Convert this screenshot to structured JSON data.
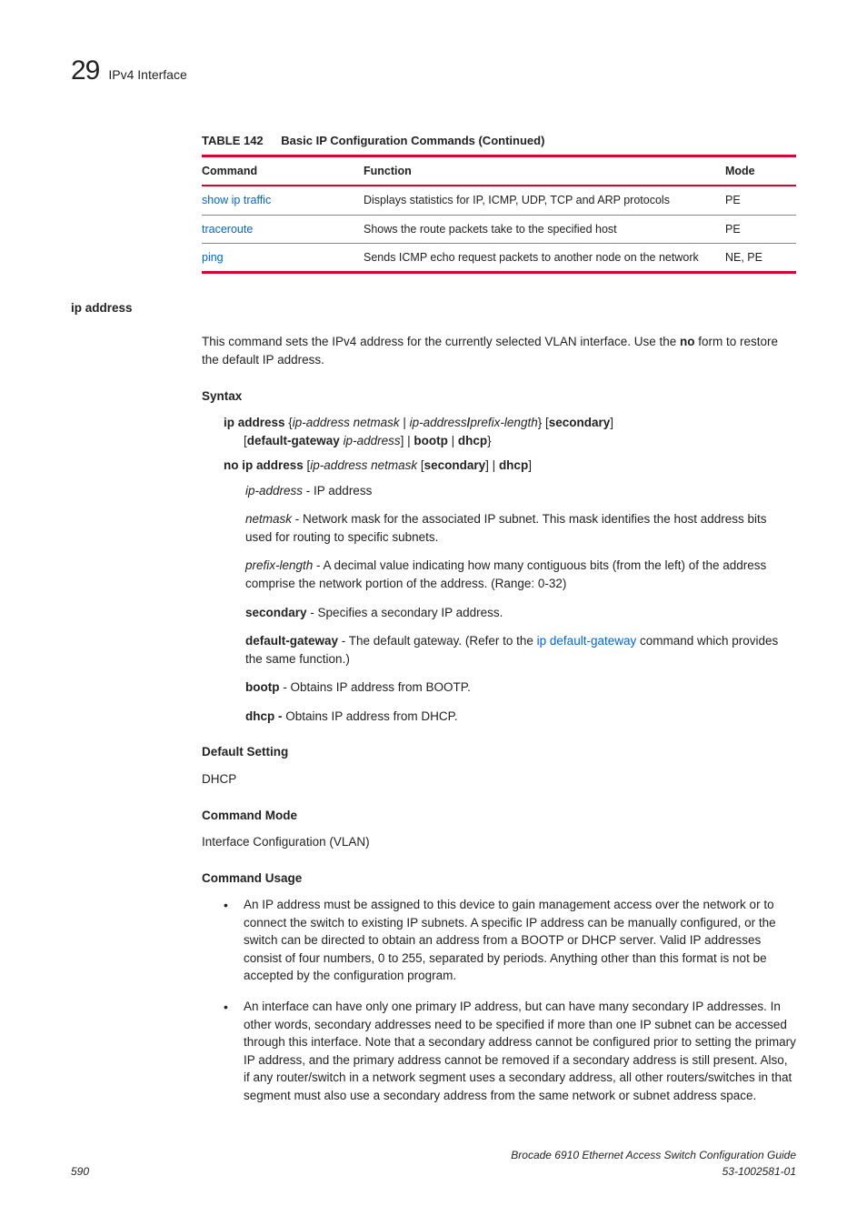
{
  "header": {
    "chapter_number": "29",
    "chapter_title": "IPv4 Interface"
  },
  "table": {
    "label": "TABLE 142",
    "title": "Basic IP Configuration Commands (Continued)",
    "columns": {
      "c0": "Command",
      "c1": "Function",
      "c2": "Mode"
    },
    "rows": [
      {
        "cmd": "show ip traffic",
        "func": "Displays statistics for IP, ICMP, UDP, TCP and ARP protocols",
        "mode": "PE"
      },
      {
        "cmd": "traceroute",
        "func": "Shows the route packets take to the specified host",
        "mode": "PE"
      },
      {
        "cmd": "ping",
        "func": "Sends ICMP echo request packets to another node on the network",
        "mode": "NE, PE"
      }
    ]
  },
  "section_title": "ip address",
  "intro_a": "This command sets the IPv4 address for the currently selected VLAN interface. Use the ",
  "intro_no": "no",
  "intro_b": " form to restore the default IP address.",
  "syntax": {
    "heading": "Syntax",
    "line1": {
      "p1": "ip address",
      "p2": " {",
      "p3": "ip-address netmask",
      "p4": " | ",
      "p5": "ip-address",
      "p6": "/",
      "p7": "prefix-length",
      "p8": "} [",
      "p9": "secondary",
      "p10": "]",
      "c1": "[",
      "c2": "default-gateway",
      "c3": " ",
      "c4": "ip-address",
      "c5": "] | ",
      "c6": "bootp",
      "c7": " | ",
      "c8": "dhcp",
      "c9": "}"
    },
    "line2": {
      "p1": "no ip address",
      "p2": " [",
      "p3": "ip-address netmask",
      "p4": " [",
      "p5": "secondary",
      "p6": "] | ",
      "p7": "dhcp",
      "p8": "]"
    }
  },
  "defs": {
    "ipaddr_term": "ip-address",
    "ipaddr_def": " - IP address",
    "netmask_term": "netmask",
    "netmask_def": " - Network mask for the associated IP subnet. This mask identifies the host address bits used for routing to specific subnets.",
    "prefix_term": "prefix-length",
    "prefix_def": " - A decimal value indicating how many contiguous bits (from the left) of the address comprise the network portion of the address. (Range: 0-32)",
    "secondary_term": "secondary",
    "secondary_def": " - Specifies a secondary IP address.",
    "dg_term": "default-gateway",
    "dg_def_a": " - The default gateway. (Refer to the ",
    "dg_link": "ip default-gateway",
    "dg_def_b": " command which provides the same function.)",
    "bootp_term": "bootp",
    "bootp_def": " - Obtains IP address from BOOTP.",
    "dhcp_term": "dhcp - ",
    "dhcp_def": "Obtains IP address from DHCP."
  },
  "default_setting": {
    "heading": "Default Setting",
    "value": "DHCP"
  },
  "command_mode": {
    "heading": "Command Mode",
    "value": "Interface Configuration (VLAN)"
  },
  "usage": {
    "heading": "Command Usage",
    "items": [
      "An IP address must be assigned to this device to gain management access over the network or to connect the switch to existing IP subnets. A specific IP address can be manually configured, or the switch can be directed to obtain an address from a BOOTP or DHCP server. Valid IP addresses consist of four numbers, 0 to 255, separated by periods. Anything other than this format is not be accepted by the configuration program.",
      "An interface can have only one primary IP address, but can have many secondary IP addresses. In other words, secondary addresses need to be specified if more than one IP subnet can be accessed through this interface. Note that a secondary address cannot be configured prior to setting the primary IP address, and the primary address cannot be removed if a secondary address is still present. Also, if any router/switch in a network segment uses a secondary address, all other routers/switches in that segment must also use a secondary address from the same network or subnet address space."
    ]
  },
  "footer": {
    "page": "590",
    "doc": "Brocade 6910 Ethernet Access Switch Configuration Guide",
    "docnum": "53-1002581-01"
  }
}
